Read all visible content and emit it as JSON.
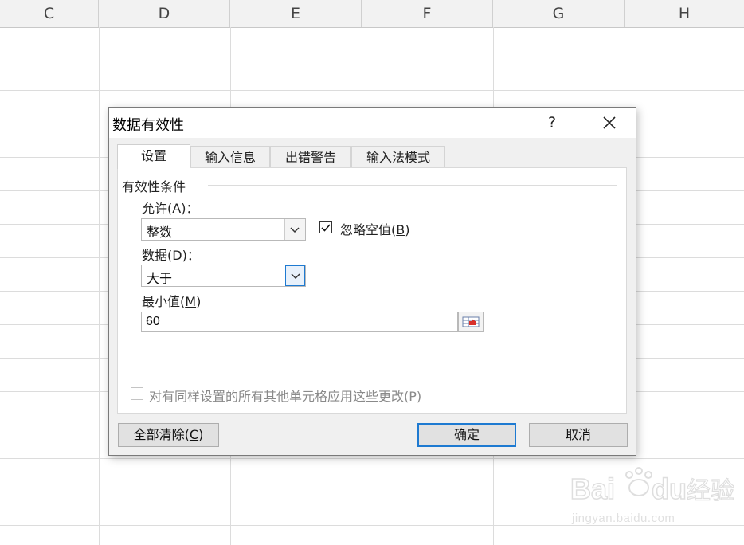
{
  "sheet": {
    "columns": [
      "C",
      "D",
      "E",
      "F",
      "G",
      "H"
    ]
  },
  "dialog": {
    "title": "数据有效性",
    "help": "?",
    "tabs": [
      "设置",
      "输入信息",
      "出错警告",
      "输入法模式"
    ],
    "active_tab": "设置",
    "group_label": "有效性条件",
    "allow_label": "允许(",
    "allow_key": "A",
    "allow_suffix": ")：",
    "allow_value": "整数",
    "ignore_blank_label": "忽略空值(",
    "ignore_blank_key": "B",
    "ignore_blank_suffix": ")",
    "ignore_blank_checked": true,
    "data_label": "数据(",
    "data_key": "D",
    "data_suffix": ")：",
    "data_value": "大于",
    "min_label": "最小值(",
    "min_key": "M",
    "min_suffix": ")",
    "min_value": "60",
    "apply_all_label": "对有同样设置的所有其他单元格应用这些更改(P)",
    "apply_all_checked": false,
    "clear_all_label": "全部清除(",
    "clear_all_key": "C",
    "clear_all_suffix": ")",
    "ok_label": "确定",
    "cancel_label": "取消"
  },
  "watermark": {
    "brand": "Bai du 经验",
    "url": "jingyan.baidu.com"
  },
  "colors": {
    "accent": "#1e7ad1",
    "header_bg": "#f2f2f2",
    "dialog_bg": "#f0f0f0"
  }
}
